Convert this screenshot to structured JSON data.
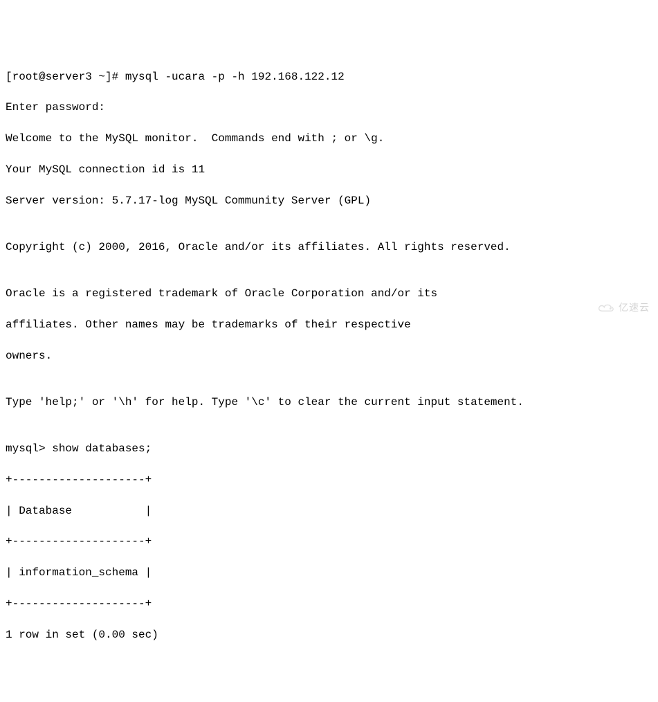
{
  "terminal": {
    "prompt_line": "[root@server3 ~]# mysql -ucara -p -h 192.168.122.12",
    "enter_password": "Enter password:",
    "welcome": "Welcome to the MySQL monitor.  Commands end with ; or \\g.",
    "connection_id": "Your MySQL connection id is 11",
    "server_version": "Server version: 5.7.17-log MySQL Community Server (GPL)",
    "blank1": "",
    "copyright": "Copyright (c) 2000, 2016, Oracle and/or its affiliates. All rights reserved.",
    "blank2": "",
    "oracle1": "Oracle is a registered trademark of Oracle Corporation and/or its",
    "oracle2": "affiliates. Other names may be trademarks of their respective",
    "oracle3": "owners.",
    "blank3": "",
    "help_line": "Type 'help;' or '\\h' for help. Type '\\c' to clear the current input statement.",
    "blank4": "",
    "mysql_prompt": "mysql> show databases;",
    "table_border_top": "+--------------------+",
    "table_header": "| Database           |",
    "table_border_mid": "+--------------------+",
    "table_row1": "| information_schema |",
    "table_border_bot": "+--------------------+",
    "result": "1 row in set (0.00 sec)"
  },
  "watermark": {
    "text": "亿速云"
  }
}
